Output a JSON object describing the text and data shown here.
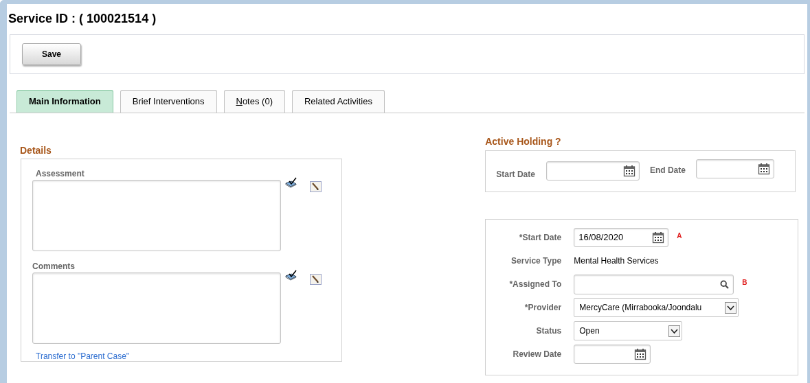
{
  "page_title": "Service ID : ( 100021514 )",
  "toolbar": {
    "buttons": [
      "Save"
    ]
  },
  "tabs": [
    {
      "label": "Main Information",
      "selected": true,
      "access_key_underlined": false
    },
    {
      "label": "Brief Interventions",
      "selected": false,
      "access_key_underlined": false
    },
    {
      "label": "Notes (0)",
      "selected": false,
      "access_key_underlined": true
    },
    {
      "label": "Related Activities",
      "selected": false,
      "access_key_underlined": false
    }
  ],
  "details": {
    "heading": "Details",
    "text_areas": [
      {
        "label": "Assessment"
      },
      {
        "label": "Comments"
      }
    ],
    "link": "Transfer to \"Parent Case\""
  },
  "active_holding": {
    "heading": "Active Holding ?",
    "start_date": {
      "label": "Start Date"
    },
    "end_date": {
      "label": "End Date"
    }
  },
  "service_form": {
    "fields": [
      {
        "kind": "date",
        "label": "*Start Date",
        "value": "16/08/2020",
        "marker": "A"
      },
      {
        "kind": "text",
        "label": "Service Type",
        "value": "Mental Health Services"
      },
      {
        "kind": "lookup",
        "label": "*Assigned To",
        "marker": "B"
      },
      {
        "kind": "select",
        "label": "*Provider",
        "value": "MercyCare (Mirrabooka/Joondalu"
      },
      {
        "kind": "select",
        "label": "Status",
        "value": "Open"
      },
      {
        "kind": "date",
        "label": "Review Date"
      }
    ]
  }
}
